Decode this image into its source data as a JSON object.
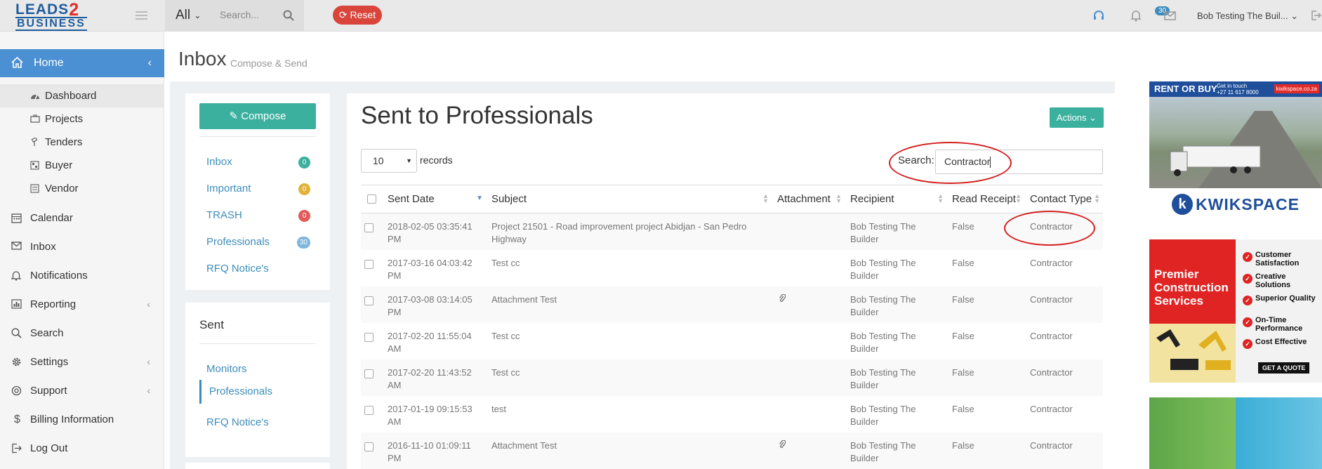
{
  "topbar": {
    "logo_line1": "LEADS",
    "logo_two": "2",
    "logo_line2": "BUSINESS",
    "scope_select": "All",
    "search_placeholder": "Search...",
    "reset_label": "Reset",
    "mail_badge": "30",
    "user_name": "Bob Testing The Buil..."
  },
  "sidebar": {
    "home": "Home",
    "sub_items": [
      "Dashboard",
      "Projects",
      "Tenders",
      "Buyer",
      "Vendor"
    ],
    "items": [
      "Calendar",
      "Inbox",
      "Notifications",
      "Reporting",
      "Search",
      "Settings",
      "Support",
      "Billing Information",
      "Log Out"
    ]
  },
  "page": {
    "title": "Inbox",
    "subtitle": "Compose & Send"
  },
  "left_panel": {
    "compose_label": "Compose",
    "folders": [
      {
        "label": "Inbox",
        "count": "0",
        "color": "#3bb09e"
      },
      {
        "label": "Important",
        "count": "0",
        "color": "#e0b43b"
      },
      {
        "label": "TRASH",
        "count": "0",
        "color": "#e25a5a"
      },
      {
        "label": "Professionals",
        "count": "30",
        "color": "#7fb6dc"
      },
      {
        "label": "RFQ Notice's",
        "count": "",
        "color": ""
      }
    ]
  },
  "sent_panel": {
    "title": "Sent",
    "links": [
      "Monitors",
      "Professionals",
      "RFQ Notice's"
    ]
  },
  "main": {
    "title": "Sent to Professionals",
    "actions_label": "Actions",
    "page_length": "10",
    "records_label": "records",
    "search_label": "Search:",
    "search_value": "Contractor",
    "columns": [
      "Sent Date",
      "Subject",
      "Attachment",
      "Recipient",
      "Read Receipt",
      "Contact Type"
    ],
    "rows": [
      {
        "date": "2018-02-05 03:35:41 PM",
        "subject": "Project 21501 - Road improvement project Abidjan - San Pedro Highway",
        "attachment": false,
        "recipient": "Bob Testing The Builder",
        "read": "False",
        "type": "Contractor"
      },
      {
        "date": "2017-03-16 04:03:42 PM",
        "subject": "Test cc",
        "attachment": false,
        "recipient": "Bob Testing The Builder",
        "read": "False",
        "type": "Contractor"
      },
      {
        "date": "2017-03-08 03:14:05 PM",
        "subject": "Attachment Test",
        "attachment": true,
        "recipient": "Bob Testing The Builder",
        "read": "False",
        "type": "Contractor"
      },
      {
        "date": "2017-02-20 11:55:04 AM",
        "subject": "Test cc",
        "attachment": false,
        "recipient": "Bob Testing The Builder",
        "read": "False",
        "type": "Contractor"
      },
      {
        "date": "2017-02-20 11:43:52 AM",
        "subject": "Test cc",
        "attachment": false,
        "recipient": "Bob Testing The Builder",
        "read": "False",
        "type": "Contractor"
      },
      {
        "date": "2017-01-19 09:15:53 AM",
        "subject": "test",
        "attachment": false,
        "recipient": "Bob Testing The Builder",
        "read": "False",
        "type": "Contractor"
      },
      {
        "date": "2016-11-10 01:09:11 PM",
        "subject": "Attachment Test",
        "attachment": true,
        "recipient": "Bob Testing The Builder",
        "read": "False",
        "type": "Contractor"
      }
    ]
  },
  "ads": {
    "ad1_headline": "RENT OR BUY",
    "ad1_contact_1": "Get in touch",
    "ad1_contact_2": "+27 11 617 8000",
    "ad1_site": "kwikspace.co.za",
    "ad1_brand_letter": "k",
    "ad1_brand": "KWIKSPACE",
    "ad2_title": "Premier Construction Services",
    "ad2_features": [
      "Customer Satisfaction",
      "Creative Solutions",
      "Superior Quality",
      "On-Time Performance",
      "Cost Effective"
    ],
    "ad2_cta": "GET A QUOTE"
  }
}
